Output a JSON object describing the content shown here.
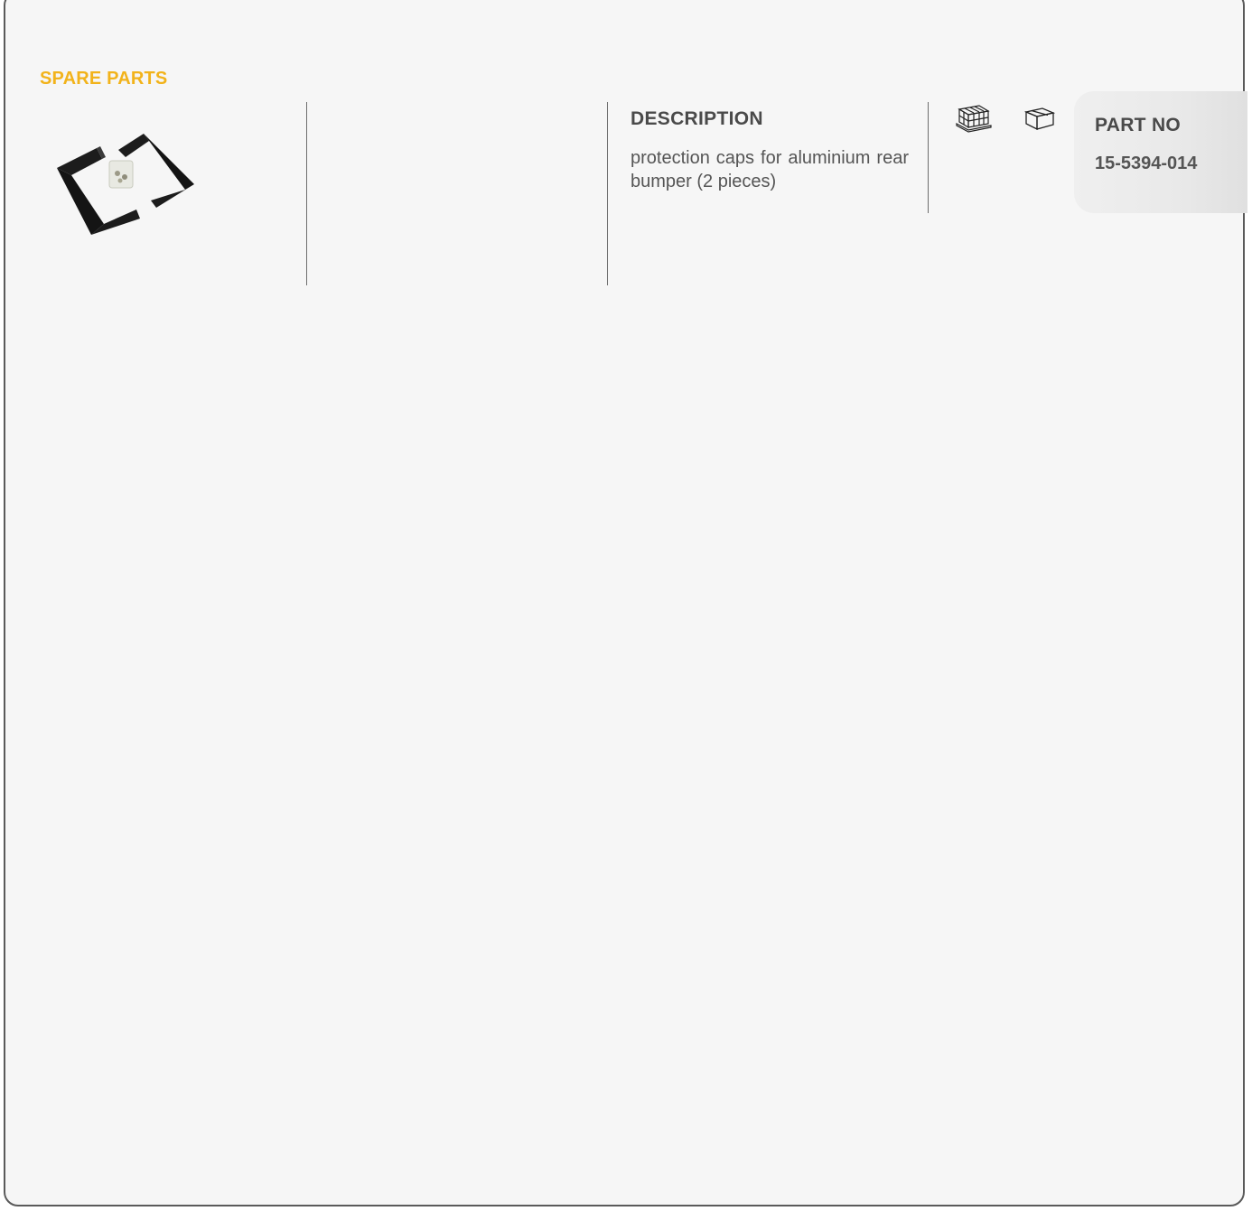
{
  "section": {
    "title": "SPARE PARTS"
  },
  "product": {
    "image_icon": "bumper-caps-image",
    "description_heading": "DESCRIPTION",
    "description": "protection caps for aluminium rear bumper (2 pieces)",
    "pallet_icon": "pallet-icon",
    "box_icon": "box-icon",
    "part_no_label": "PART NO",
    "part_no": "15-5394-014"
  },
  "colors": {
    "accent": "#f2b31b",
    "background": "#f6f6f6",
    "text": "#555555",
    "divider": "#6e6e6e"
  }
}
